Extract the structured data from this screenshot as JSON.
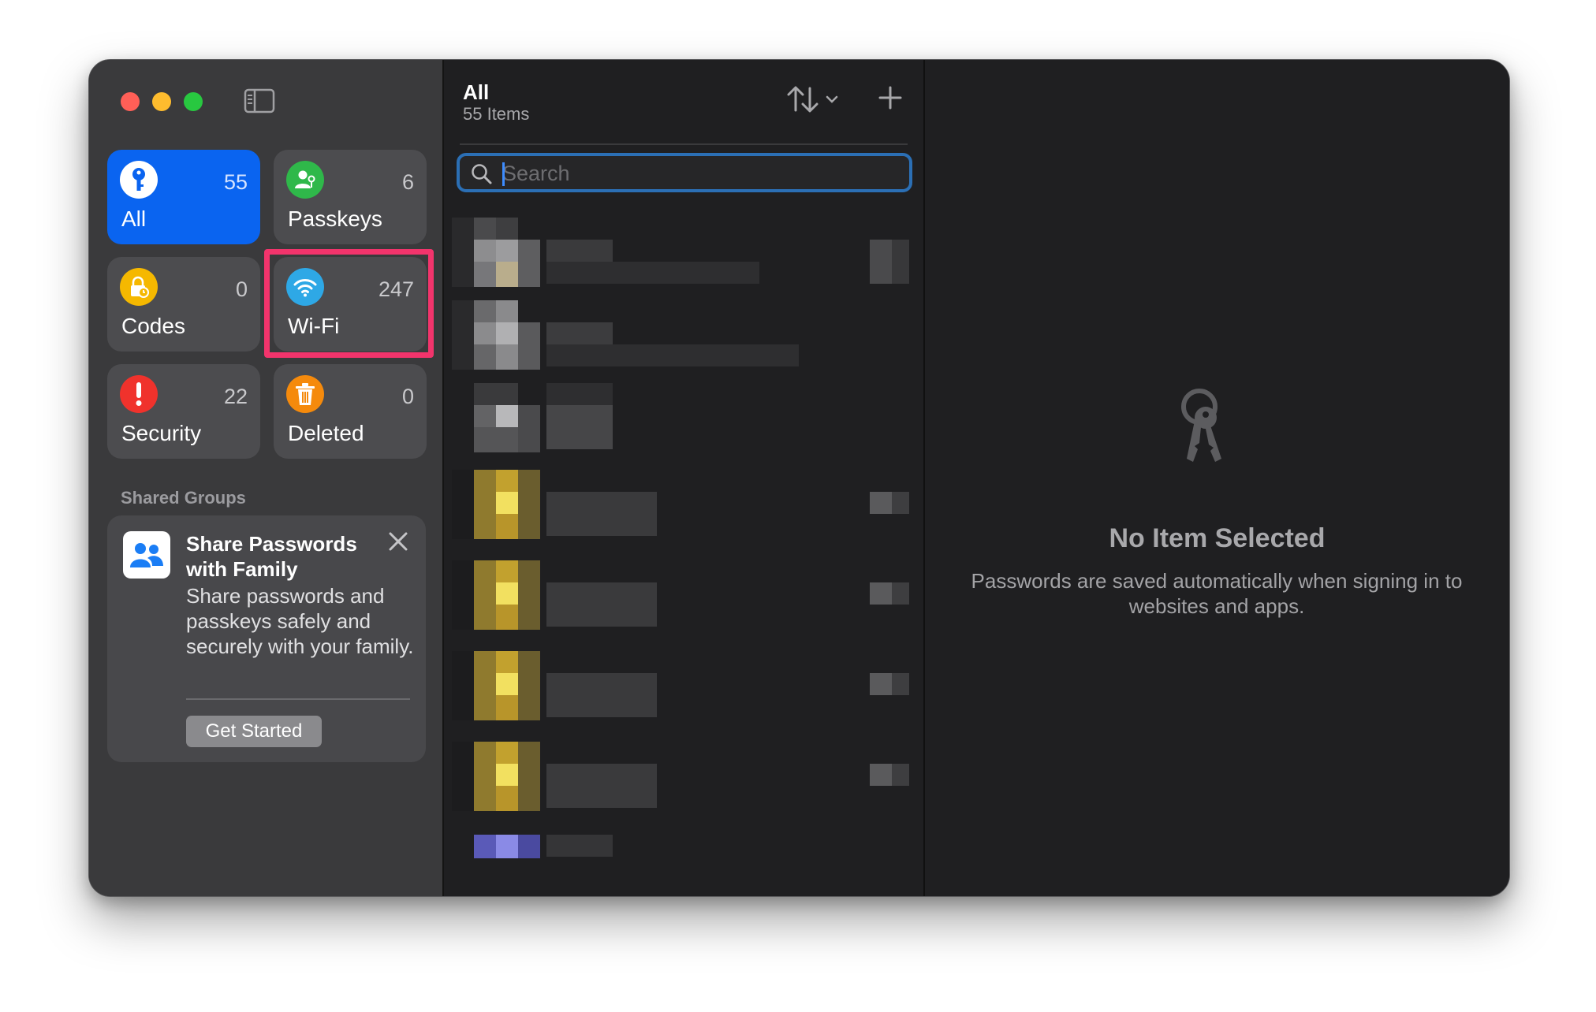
{
  "sidebar": {
    "toggle_icon": "sidebar-toggle-icon",
    "categories": [
      {
        "id": "all",
        "label": "All",
        "count": "55",
        "icon": "key-icon",
        "color": "#0a64f0",
        "selected": true
      },
      {
        "id": "passkeys",
        "label": "Passkeys",
        "count": "6",
        "icon": "person-key-icon",
        "color": "#2fb84a"
      },
      {
        "id": "codes",
        "label": "Codes",
        "count": "0",
        "icon": "lock-clock-icon",
        "color": "#f5b800"
      },
      {
        "id": "wifi",
        "label": "Wi-Fi",
        "count": "247",
        "icon": "wifi-icon",
        "color": "#2ea8e6",
        "highlighted": true
      },
      {
        "id": "security",
        "label": "Security",
        "count": "22",
        "icon": "exclamation-icon",
        "color": "#f0322c"
      },
      {
        "id": "deleted",
        "label": "Deleted",
        "count": "0",
        "icon": "trash-icon",
        "color": "#f58a0c"
      }
    ],
    "shared_groups_title": "Shared Groups",
    "share_card": {
      "title": "Share Passwords with Family",
      "description": "Share passwords and passkeys safely and securely with your family.",
      "button_label": "Get Started"
    }
  },
  "list": {
    "title": "All",
    "subtitle": "55 Items",
    "search_placeholder": "Search"
  },
  "detail": {
    "empty_title": "No Item Selected",
    "empty_description": "Passwords are saved automatically when signing in to websites and apps."
  }
}
